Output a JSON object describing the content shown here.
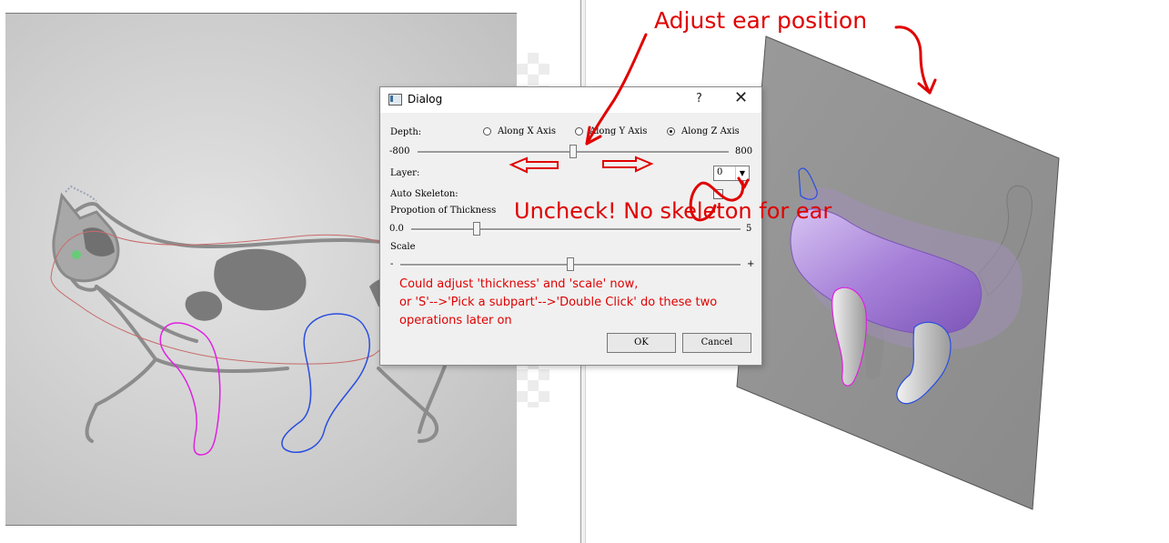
{
  "dialog": {
    "title": "Dialog",
    "help_glyph": "?",
    "close_glyph": "✕",
    "depth_label": "Depth:",
    "axis_options": [
      "Along X Axis",
      "Along Y Axis",
      "Along Z Axis"
    ],
    "selected_axis": "Along Z Axis",
    "depth_min": "-800",
    "depth_max": "800",
    "depth_value": 0,
    "layer_label": "Layer:",
    "layer_value": "0",
    "auto_skeleton_label": "Auto Skeleton:",
    "auto_skeleton_checked": false,
    "thickness_label": "Propotion of Thickness",
    "thickness_min": "0.0",
    "thickness_max": "5",
    "thickness_fraction": 0.2,
    "scale_label": "Scale",
    "scale_minus": "-",
    "scale_plus": "+",
    "scale_fraction": 0.5,
    "note_lines": [
      "Could adjust 'thickness' and 'scale' now,",
      "or 'S'-->'Pick a subpart'-->'Double Click' do these two",
      "operations later on"
    ],
    "ok_label": "OK",
    "cancel_label": "Cancel"
  },
  "annotations": {
    "adjust_ear": "Adjust ear position",
    "uncheck_note": "Uncheck! No skeleton for ear",
    "color": "#e00000"
  },
  "colors": {
    "accent_purple": "#a680d8",
    "outline_magenta": "#e020e0",
    "outline_blue": "#2a4ee0",
    "plane_gray": "#9a9a9a"
  }
}
